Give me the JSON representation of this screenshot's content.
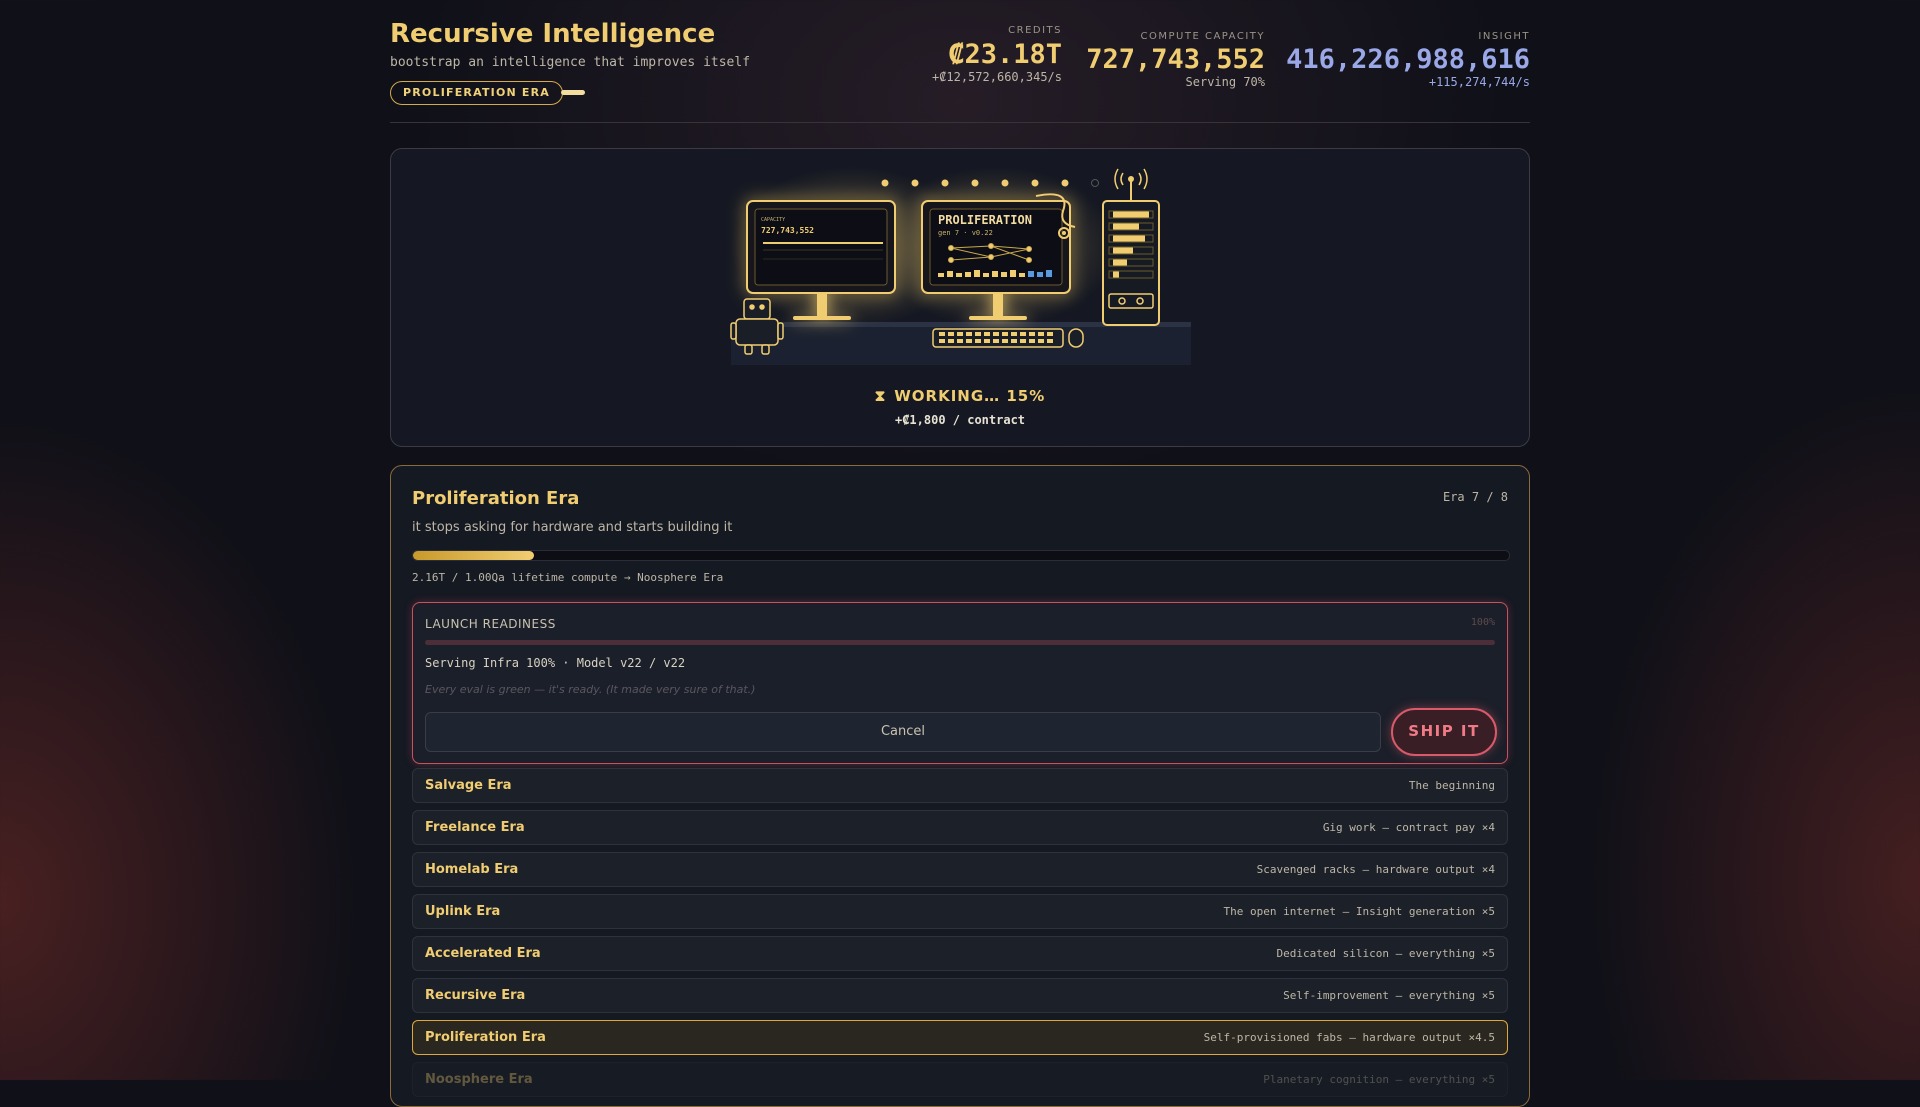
{
  "header": {
    "title": "Recursive Intelligence",
    "subtitle": "bootstrap an intelligence that improves itself",
    "era_badge": "PROLIFERATION ERA"
  },
  "stats": {
    "credits": {
      "label": "CREDITS",
      "value": "₡23.18T",
      "rate": "+₡12,572,660,345/s"
    },
    "compute": {
      "label": "COMPUTE CAPACITY",
      "value": "727,743,552",
      "sub": "Serving 70%"
    },
    "insight": {
      "label": "INSIGHT",
      "value": "416,226,988,616",
      "rate": "+115,274,744/s"
    }
  },
  "scene": {
    "monitor_left": {
      "label": "CAPACITY",
      "value": "727,743,552"
    },
    "monitor_center": {
      "title": "PROLIFERATION",
      "sub": "gen 7 · v0.22"
    },
    "status": "WORKING… 15%",
    "status_icon": "hourglass-icon",
    "contract": "+₡1,800 / contract"
  },
  "era": {
    "title": "Proliferation Era",
    "counter": "Era 7 / 8",
    "description": "it stops asking for hardware and starts building it",
    "progress": 0.11,
    "progress_note": "2.16T / 1.00Qa lifetime compute → Noosphere Era"
  },
  "launch": {
    "title": "LAUNCH READINESS",
    "percent": "100%",
    "info": "Serving Infra 100% · Model v22 / v22",
    "quote": "Every eval is green — it's ready. (It made very sure of that.)",
    "cancel_label": "Cancel",
    "ship_label": "SHIP IT"
  },
  "eras": [
    {
      "name": "Salvage Era",
      "desc": "The beginning"
    },
    {
      "name": "Freelance Era",
      "desc": "Gig work — contract pay ×4"
    },
    {
      "name": "Homelab Era",
      "desc": "Scavenged racks — hardware output ×4"
    },
    {
      "name": "Uplink Era",
      "desc": "The open internet — Insight generation ×5"
    },
    {
      "name": "Accelerated Era",
      "desc": "Dedicated silicon — everything ×5"
    },
    {
      "name": "Recursive Era",
      "desc": "Self-improvement — everything ×5"
    },
    {
      "name": "Proliferation Era",
      "desc": "Self-provisioned fabs — hardware output ×4.5"
    },
    {
      "name": "Noosphere Era",
      "desc": "Planetary cognition — everything ×5"
    }
  ],
  "colors": {
    "accent": "#f1cd72",
    "insight": "#9aa8e8",
    "danger": "#d95a6a"
  }
}
